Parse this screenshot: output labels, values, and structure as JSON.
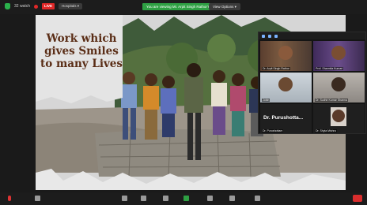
{
  "topbar": {
    "participants_label": "32 watch",
    "live_label": "LIVE",
    "host_label": "Hospitals ▾",
    "banner_text": "You are viewing Mr. Arpit Singh Rathor's screen",
    "view_options": "View Options ▾"
  },
  "slide": {
    "headline": "Work which gives Smiles to many Lives"
  },
  "participants": [
    {
      "name": "Dr. Arpit Singh Rathor",
      "type": "video"
    },
    {
      "name": "Prof. Sharmila Kumari",
      "type": "video"
    },
    {
      "name": "Jobin",
      "type": "video"
    },
    {
      "name": "Dr. Sudhir Kumar Sharma",
      "type": "video"
    },
    {
      "name": "Dr. Purushottam",
      "type": "name-only",
      "display": "Dr. Purushotta..."
    },
    {
      "name": "Dr. Shyla Mishra",
      "type": "video"
    }
  ],
  "colors": {
    "banner": "#2ea043",
    "live": "#e02828",
    "headline": "#5a2d16"
  }
}
